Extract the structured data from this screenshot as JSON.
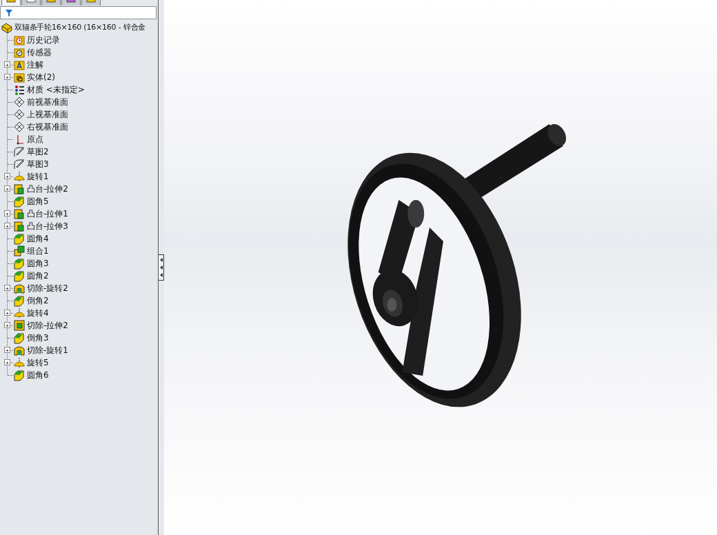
{
  "panel_tabs": [
    {
      "kind": "features",
      "selected": true
    },
    {
      "kind": "properties",
      "selected": false
    },
    {
      "kind": "configurations",
      "selected": false
    },
    {
      "kind": "dimxpert",
      "selected": false
    },
    {
      "kind": "display",
      "selected": false
    }
  ],
  "tree": {
    "root": {
      "label": "双辐条手轮16×160  (16×160 - 锌合金",
      "kind": "part"
    },
    "items": [
      {
        "label": "历史记录",
        "kind": "history",
        "expandable": false
      },
      {
        "label": "传感器",
        "kind": "sensor",
        "expandable": false
      },
      {
        "label": "注解",
        "kind": "annotation",
        "expandable": true
      },
      {
        "label": "实体(2)",
        "kind": "bodies",
        "expandable": true
      },
      {
        "label": "材质 <未指定>",
        "kind": "material",
        "expandable": false
      },
      {
        "label": "前视基准面",
        "kind": "plane",
        "expandable": false
      },
      {
        "label": "上视基准面",
        "kind": "plane",
        "expandable": false
      },
      {
        "label": "右视基准面",
        "kind": "plane",
        "expandable": false
      },
      {
        "label": "原点",
        "kind": "origin",
        "expandable": false
      },
      {
        "label": "草图2",
        "kind": "sketch",
        "expandable": false
      },
      {
        "label": "草图3",
        "kind": "sketch",
        "expandable": false
      },
      {
        "label": "旋转1",
        "kind": "revolve",
        "expandable": true
      },
      {
        "label": "凸台-拉伸2",
        "kind": "extrude",
        "expandable": true
      },
      {
        "label": "圆角5",
        "kind": "fillet",
        "expandable": false
      },
      {
        "label": "凸台-拉伸1",
        "kind": "extrude",
        "expandable": true
      },
      {
        "label": "凸台-拉伸3",
        "kind": "extrude",
        "expandable": true
      },
      {
        "label": "圆角4",
        "kind": "fillet",
        "expandable": false
      },
      {
        "label": "组合1",
        "kind": "combine",
        "expandable": false
      },
      {
        "label": "圆角3",
        "kind": "fillet",
        "expandable": false
      },
      {
        "label": "圆角2",
        "kind": "fillet",
        "expandable": false
      },
      {
        "label": "切除-旋转2",
        "kind": "cutrevolve",
        "expandable": true
      },
      {
        "label": "倒角2",
        "kind": "chamfer",
        "expandable": false
      },
      {
        "label": "旋转4",
        "kind": "revolve",
        "expandable": true
      },
      {
        "label": "切除-拉伸2",
        "kind": "cutextrude",
        "expandable": true
      },
      {
        "label": "倒角3",
        "kind": "chamfer",
        "expandable": false
      },
      {
        "label": "切除-旋转1",
        "kind": "cutrevolve",
        "expandable": true
      },
      {
        "label": "旋转5",
        "kind": "revolve",
        "expandable": true
      },
      {
        "label": "圆角6",
        "kind": "fillet",
        "expandable": false
      }
    ]
  }
}
